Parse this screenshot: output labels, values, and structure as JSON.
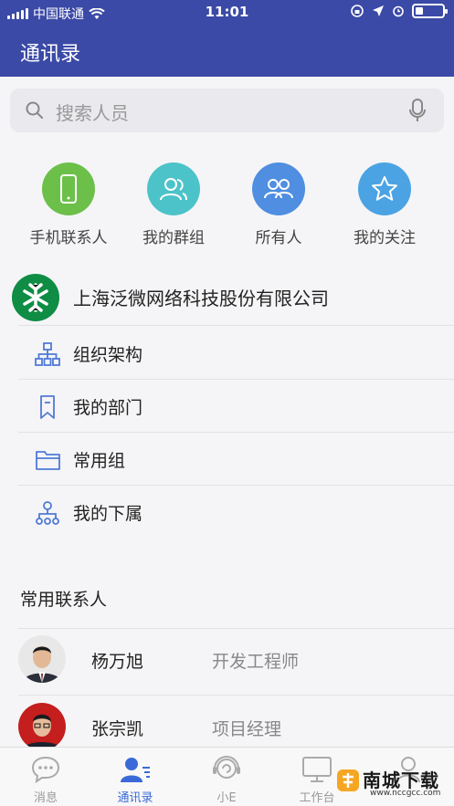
{
  "status_bar": {
    "carrier": "中国联通",
    "time": "11:01",
    "battery_level": 0.3
  },
  "header": {
    "title": "通讯录"
  },
  "search": {
    "placeholder": "搜索人员"
  },
  "quick_entries": [
    {
      "label": "手机联系人",
      "icon": "phone-icon",
      "color": "#6cc04a"
    },
    {
      "label": "我的群组",
      "icon": "group-icon",
      "color": "#4cc3c8"
    },
    {
      "label": "所有人",
      "icon": "people-icon",
      "color": "#4f8ee0"
    },
    {
      "label": "我的关注",
      "icon": "star-icon",
      "color": "#4ba3e3"
    }
  ],
  "company": {
    "name": "上海泛微网络科技股份有限公司"
  },
  "org_items": [
    {
      "label": "组织架构",
      "icon": "org-chart-icon"
    },
    {
      "label": "我的部门",
      "icon": "bookmark-icon"
    },
    {
      "label": "常用组",
      "icon": "folder-icon"
    },
    {
      "label": "我的下属",
      "icon": "subordinate-icon"
    }
  ],
  "frequent_contacts": {
    "title": "常用联系人",
    "items": [
      {
        "name": "杨万旭",
        "title": "开发工程师"
      },
      {
        "name": "张宗凯",
        "title": "项目经理"
      }
    ]
  },
  "tabbar": {
    "tabs": [
      {
        "label": "消息",
        "icon": "chat-bubble-icon"
      },
      {
        "label": "通讯录",
        "icon": "contacts-icon",
        "active": true
      },
      {
        "label": "小E",
        "icon": "assistant-icon"
      },
      {
        "label": "工作台",
        "icon": "monitor-icon"
      },
      {
        "label": "",
        "icon": "profile-icon"
      }
    ]
  },
  "watermark": {
    "text": "南城下载",
    "sub": "www.nccgcc.com"
  },
  "colors": {
    "primary": "#3b4aa6",
    "active_tab": "#3b6ad8"
  }
}
